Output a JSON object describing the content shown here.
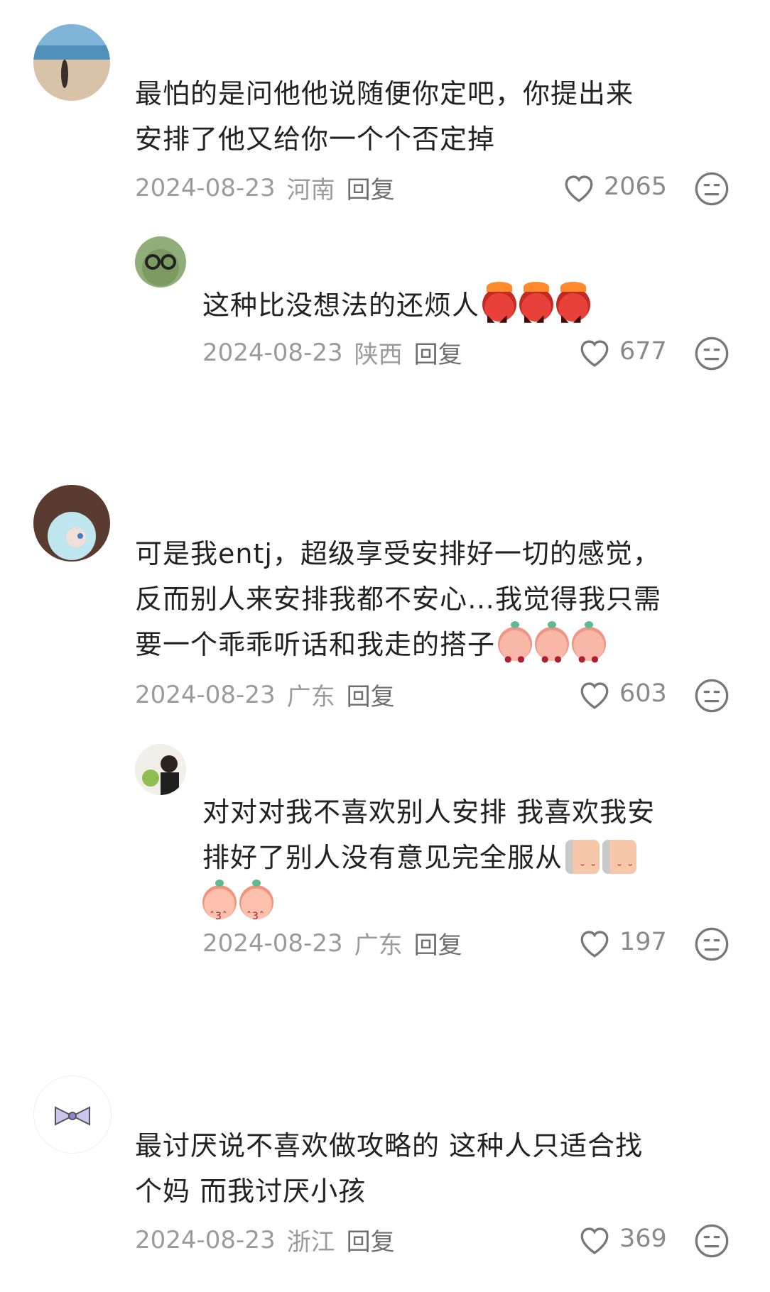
{
  "comments": [
    {
      "text_lines": [
        "最怕的是问他他说随便你定吧，你提出来",
        "安排了他又给你一个个否定掉"
      ],
      "date": "2024-08-23",
      "region": "河南",
      "reply_label": "回复",
      "likes": "2065",
      "reply": {
        "text_lines": [
          "这种比没想法的还烦人"
        ],
        "emoji": [
          "angry-face-emoji",
          "angry-face-emoji",
          "angry-face-emoji"
        ],
        "date": "2024-08-23",
        "region": "陕西",
        "reply_label": "回复",
        "likes": "677"
      }
    },
    {
      "text_lines": [
        "可是我entj，超级享受安排好一切的感觉，",
        "反而别人来安排我都不安心…我觉得我只需",
        "要一个乖乖听话和我走的搭子"
      ],
      "emoji": [
        "pleading-face-emoji",
        "pleading-face-emoji",
        "pleading-face-emoji"
      ],
      "date": "2024-08-23",
      "region": "广东",
      "reply_label": "回复",
      "likes": "603",
      "reply": {
        "text_lines": [
          "对对对我不喜欢别人安排 我喜欢我安",
          "排好了别人没有意见完全服从"
        ],
        "emoji": [
          "peeking-face-emoji",
          "peeking-face-emoji",
          "kissing-face-emoji",
          "kissing-face-emoji"
        ],
        "date": "2024-08-23",
        "region": "广东",
        "reply_label": "回复",
        "likes": "197"
      }
    },
    {
      "text_lines": [
        "最讨厌说不喜欢做攻略的 这种人只适合找",
        "个妈 而我讨厌小孩"
      ],
      "date": "2024-08-23",
      "region": "浙江",
      "reply_label": "回复",
      "likes": "369"
    }
  ],
  "icons": {
    "like": "heart-outline-icon",
    "dislike": "meh-face-icon"
  },
  "colors": {
    "meta": "#9b9b9b",
    "text": "#222222",
    "icon": "#8a8a8a"
  }
}
